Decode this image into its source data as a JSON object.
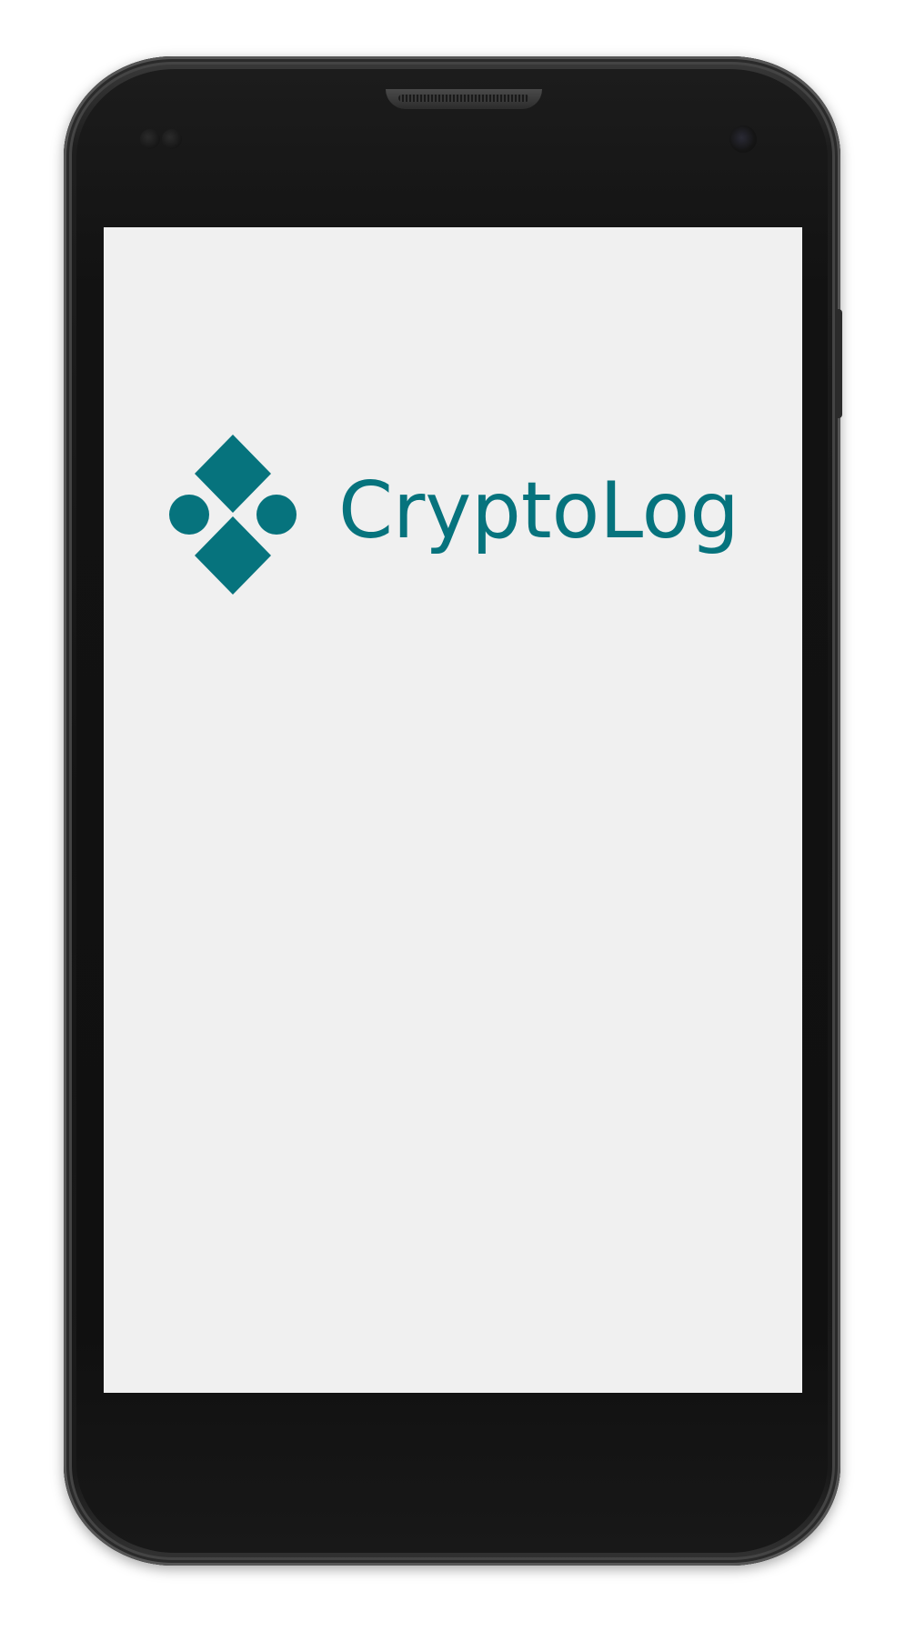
{
  "app": {
    "brand_name": "CryptoLog",
    "logo_icon": "diamond-circles-logo-icon"
  },
  "colors": {
    "brand": "#06737d",
    "screen_background": "#f0f0f0",
    "device_frame": "#141414"
  }
}
